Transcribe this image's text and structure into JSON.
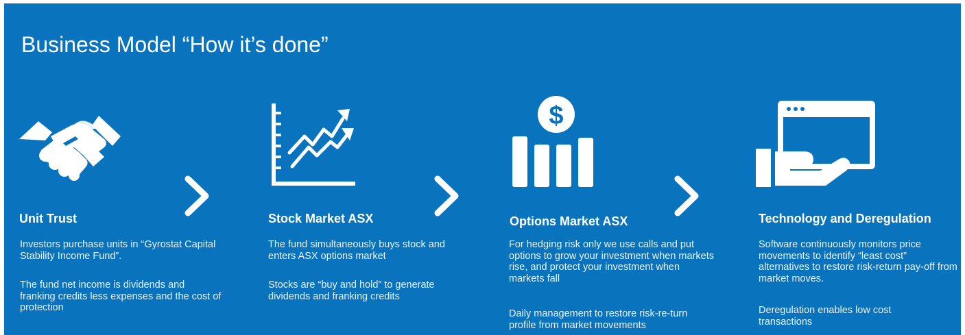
{
  "title": "Business Model “How it’s done”",
  "colors": {
    "background": "#0a73bd",
    "foreground": "#ffffff"
  },
  "steps": [
    {
      "icon": "handshake-icon",
      "heading": "Unit Trust",
      "paragraphs": [
        "Investors purchase units in “Gyrostat Capital Stability Income Fund”.",
        "The fund net income is dividends and franking credits less expenses and the cost of protection"
      ]
    },
    {
      "icon": "rising-chart-icon",
      "heading": "Stock Market ASX",
      "paragraphs": [
        "The fund simultaneously buys stock and enters ASX options market",
        "Stocks are “buy and hold” to generate dividends and franking credits"
      ]
    },
    {
      "icon": "dollar-bar-chart-icon",
      "heading": "Options Market ASX",
      "paragraphs": [
        "For hedging risk only we use calls and put options to grow your investment when markets rise, and protect your investment when markets fall",
        "Daily management to restore risk-re-turn profile from market movements"
      ]
    },
    {
      "icon": "hand-browser-icon",
      "heading": "Technology and Deregulation",
      "paragraphs": [
        "Software continuously monitors price movements to identify “least cost” alternatives to restore risk-return pay-off from market moves.",
        "Deregulation enables low cost transactions"
      ]
    }
  ],
  "arrows": [
    "chevron-right-icon",
    "chevron-right-icon",
    "chevron-right-icon"
  ]
}
